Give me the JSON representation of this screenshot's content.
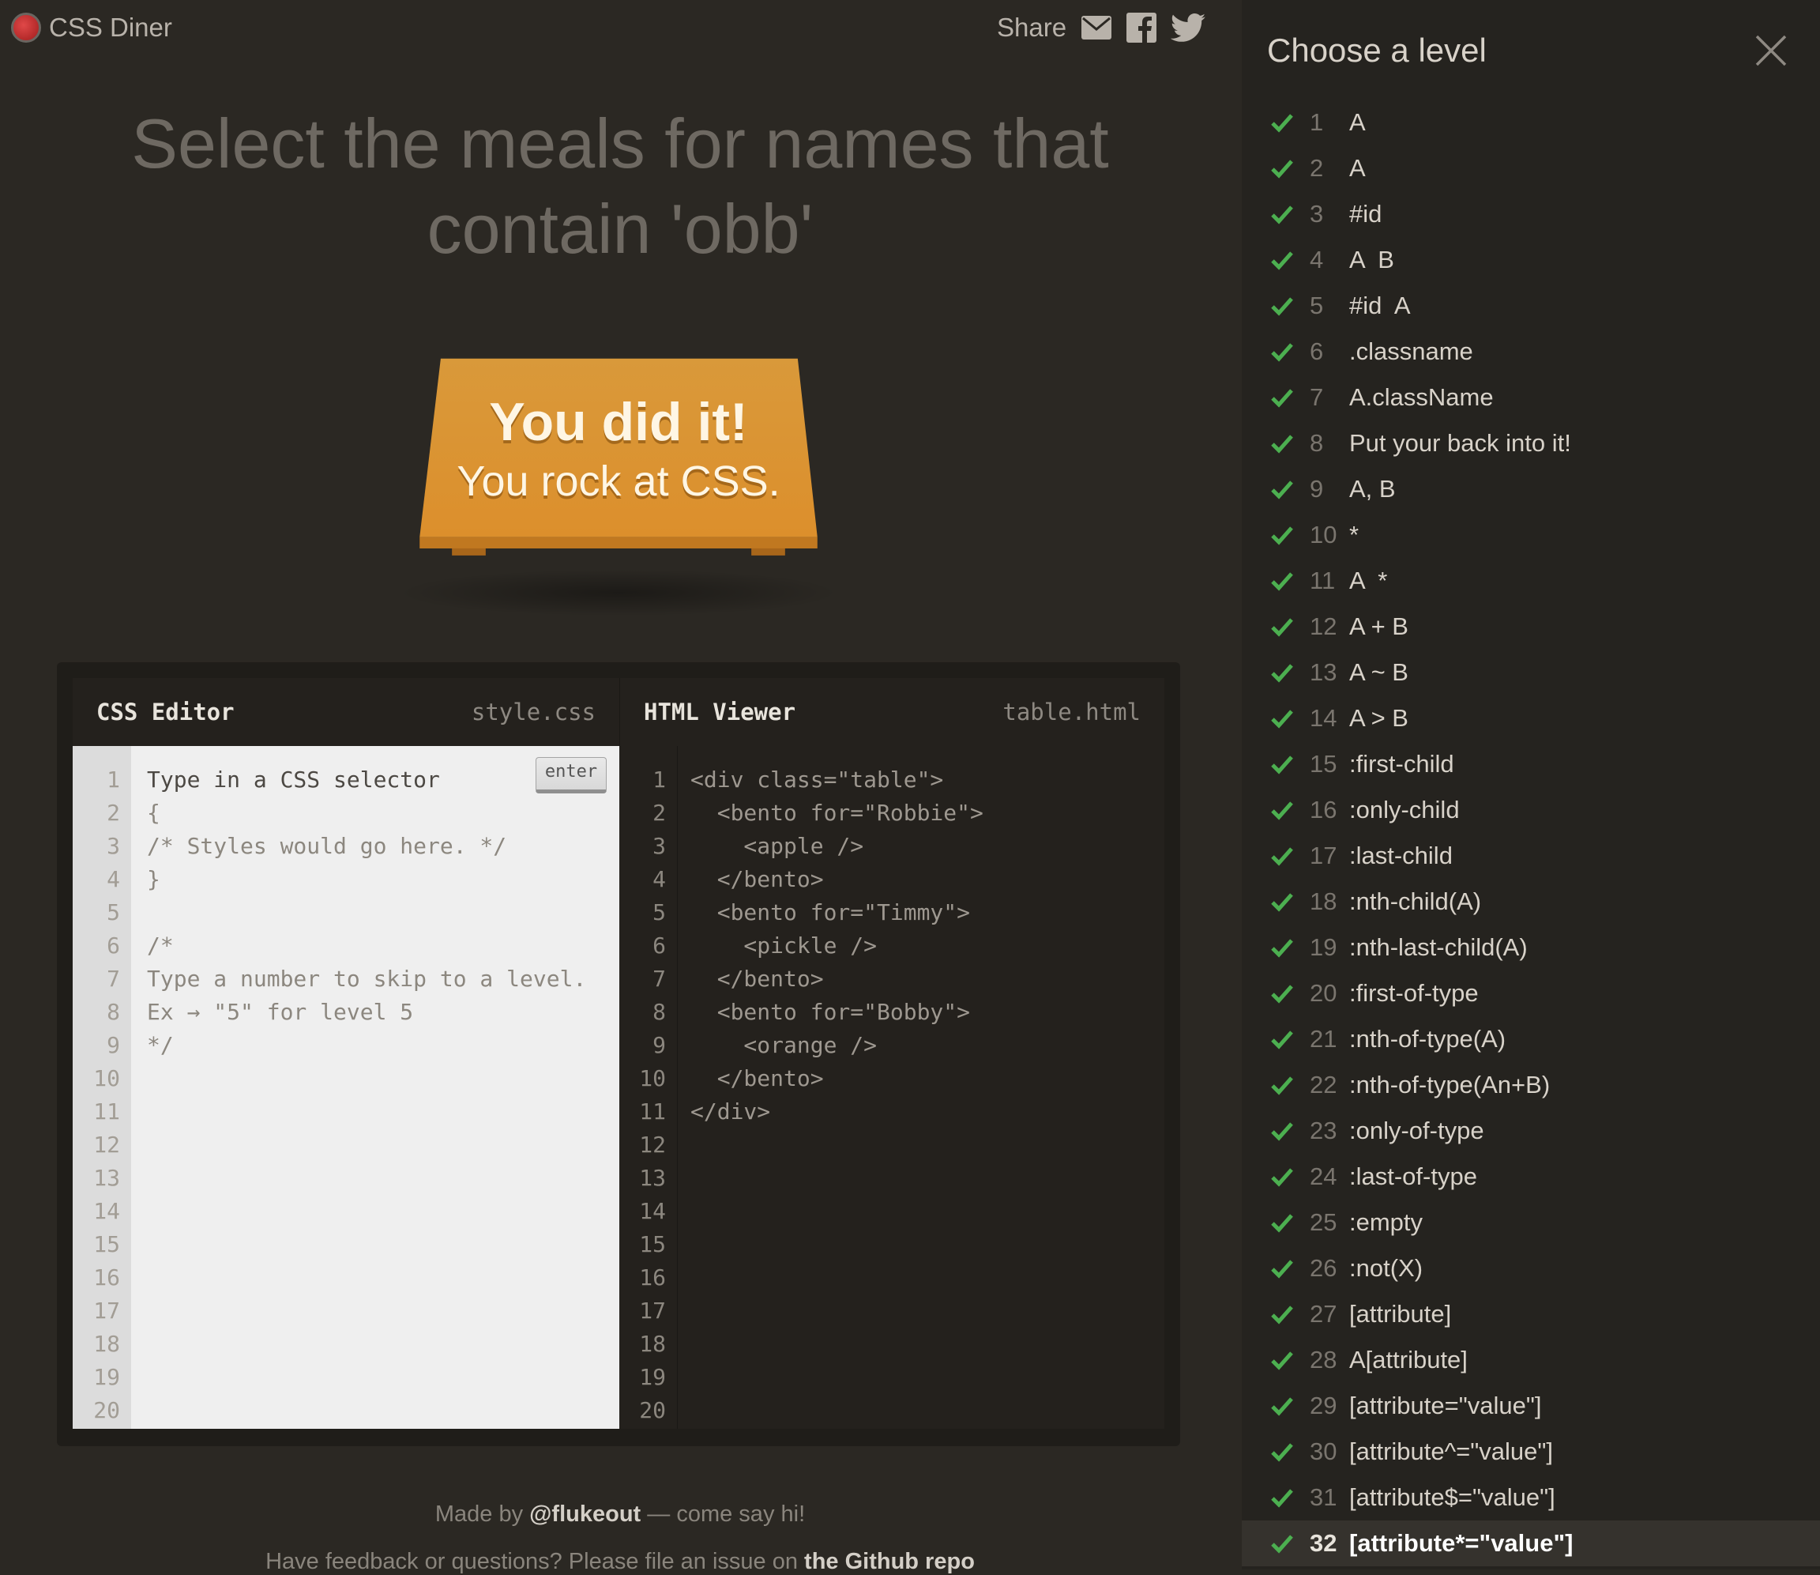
{
  "header": {
    "logo_text": "CSS Diner",
    "share_label": "Share"
  },
  "instruction": {
    "line1": "Select the meals for names that",
    "line2": "contain 'obb'"
  },
  "plate": {
    "line1": "You did it!",
    "line2": "You rock at CSS."
  },
  "editor": {
    "css_title": "CSS Editor",
    "css_file": "style.css",
    "html_title": "HTML Viewer",
    "html_file": "table.html",
    "enter_label": "enter",
    "css_lines": [
      "Type in a CSS selector",
      "{",
      "/* Styles would go here. */",
      "}",
      "",
      "/*",
      "Type a number to skip to a level.",
      "Ex → \"5\" for level 5",
      "*/"
    ],
    "html_lines": [
      "<div class=\"table\">",
      "  <bento for=\"Robbie\">",
      "    <apple />",
      "  </bento>",
      "  <bento for=\"Timmy\">",
      "    <pickle />",
      "  </bento>",
      "  <bento for=\"Bobby\">",
      "    <orange />",
      "  </bento>",
      "</div>"
    ],
    "line_numbers": [
      "1",
      "2",
      "3",
      "4",
      "5",
      "6",
      "7",
      "8",
      "9",
      "10",
      "11",
      "12",
      "13",
      "14",
      "15",
      "16",
      "17",
      "18",
      "19",
      "20"
    ]
  },
  "footer": {
    "made_by_prefix": "Made by",
    "made_by_handle": "@flukeout",
    "made_by_suffix": "— come say hi!",
    "feedback_prefix": "Have feedback or questions? Please file an issue on",
    "feedback_link": "the Github repo"
  },
  "sidebar": {
    "title": "Choose a level",
    "current_level": "32",
    "check_color": "#4caf50",
    "levels": [
      {
        "num": "1",
        "selector": "A"
      },
      {
        "num": "2",
        "selector": "A"
      },
      {
        "num": "3",
        "selector": "#id"
      },
      {
        "num": "4",
        "selector": "A  B"
      },
      {
        "num": "5",
        "selector": "#id  A"
      },
      {
        "num": "6",
        "selector": ".classname"
      },
      {
        "num": "7",
        "selector": "A.className"
      },
      {
        "num": "8",
        "selector": "Put your back into it!"
      },
      {
        "num": "9",
        "selector": "A, B"
      },
      {
        "num": "10",
        "selector": "*"
      },
      {
        "num": "11",
        "selector": "A  *"
      },
      {
        "num": "12",
        "selector": "A + B"
      },
      {
        "num": "13",
        "selector": "A ~ B"
      },
      {
        "num": "14",
        "selector": "A > B"
      },
      {
        "num": "15",
        "selector": ":first-child"
      },
      {
        "num": "16",
        "selector": ":only-child"
      },
      {
        "num": "17",
        "selector": ":last-child"
      },
      {
        "num": "18",
        "selector": ":nth-child(A)"
      },
      {
        "num": "19",
        "selector": ":nth-last-child(A)"
      },
      {
        "num": "20",
        "selector": ":first-of-type"
      },
      {
        "num": "21",
        "selector": ":nth-of-type(A)"
      },
      {
        "num": "22",
        "selector": ":nth-of-type(An+B)"
      },
      {
        "num": "23",
        "selector": ":only-of-type"
      },
      {
        "num": "24",
        "selector": ":last-of-type"
      },
      {
        "num": "25",
        "selector": ":empty"
      },
      {
        "num": "26",
        "selector": ":not(X)"
      },
      {
        "num": "27",
        "selector": "[attribute]"
      },
      {
        "num": "28",
        "selector": "A[attribute]"
      },
      {
        "num": "29",
        "selector": "[attribute=\"value\"]"
      },
      {
        "num": "30",
        "selector": "[attribute^=\"value\"]"
      },
      {
        "num": "31",
        "selector": "[attribute$=\"value\"]"
      },
      {
        "num": "32",
        "selector": "[attribute*=\"value\"]"
      }
    ]
  }
}
